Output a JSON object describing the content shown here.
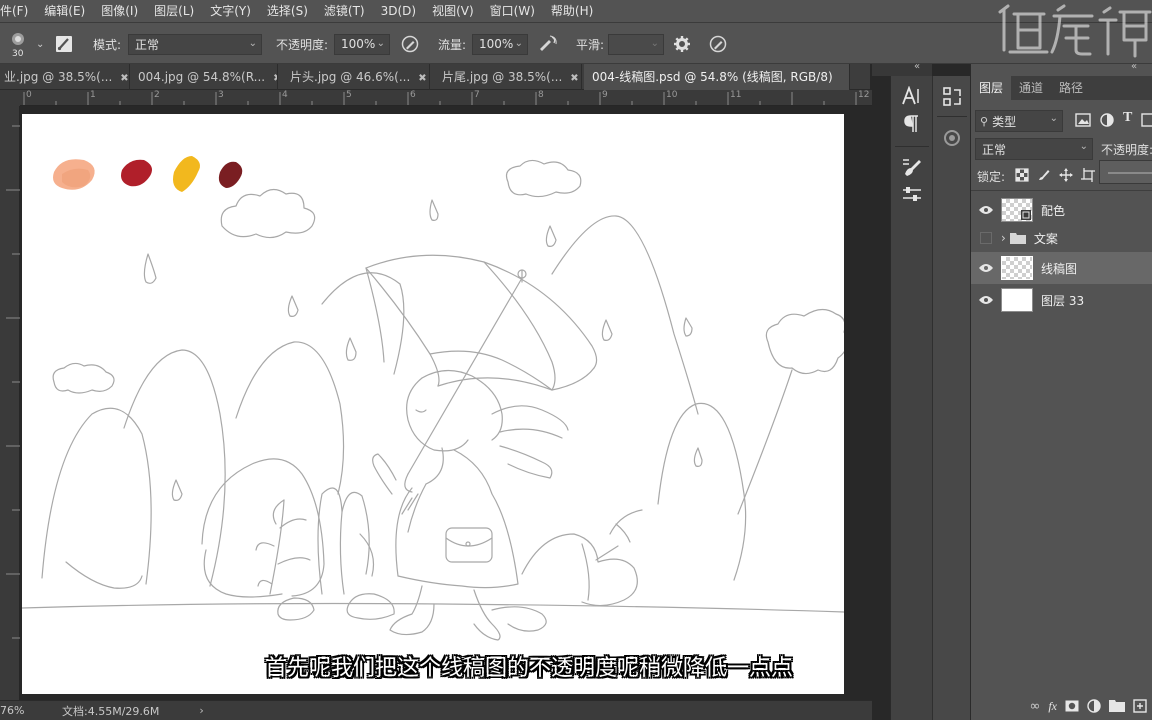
{
  "menu": [
    "件(F)",
    "编辑(E)",
    "图像(I)",
    "图层(L)",
    "文字(Y)",
    "选择(S)",
    "滤镜(T)",
    "3D(D)",
    "视图(V)",
    "窗口(W)",
    "帮助(H)"
  ],
  "options": {
    "brush_size": "30",
    "mode_label": "模式:",
    "mode_value": "正常",
    "opacity_label": "不透明度:",
    "opacity_value": "100%",
    "flow_label": "流量:",
    "flow_value": "100%",
    "smooth_label": "平滑:",
    "smooth_value": ""
  },
  "tabs": [
    {
      "label": "业.jpg @ 38.5%(...",
      "active": false
    },
    {
      "label": "004.jpg @ 54.8%(R...",
      "active": false
    },
    {
      "label": "片头.jpg @ 46.6%(...",
      "active": false
    },
    {
      "label": "片尾.jpg @ 38.5%(...",
      "active": false
    },
    {
      "label": "004-线稿图.psd @ 54.8% (线稿图, RGB/8)",
      "active": true
    }
  ],
  "ruler_numbers": [
    "0",
    "1",
    "2",
    "3",
    "4",
    "5",
    "6",
    "7",
    "8",
    "9",
    "10",
    "11",
    "12"
  ],
  "status": {
    "zoom": "76%",
    "doc": "文档:4.55M/29.6M"
  },
  "layers_panel": {
    "tabs": [
      "图层",
      "通道",
      "路径"
    ],
    "filter_label": "类型",
    "blend_mode": "正常",
    "opacity_label": "不透明度:",
    "lock_label": "锁定:",
    "layers": [
      {
        "name": "配色",
        "visible": true,
        "selected": false,
        "kind": "pixel"
      },
      {
        "name": "文案",
        "visible": false,
        "selected": false,
        "kind": "group"
      },
      {
        "name": "线稿图",
        "visible": true,
        "selected": true,
        "kind": "pixel"
      },
      {
        "name": "图层 33",
        "visible": true,
        "selected": false,
        "kind": "white"
      }
    ]
  },
  "subtitle": "首先呢我们把这个线稿图的不透明度呢稍微降低一点点",
  "palette_colors": [
    "#f6b08e",
    "#b01f2a",
    "#f2b81e",
    "#7a1e22"
  ]
}
